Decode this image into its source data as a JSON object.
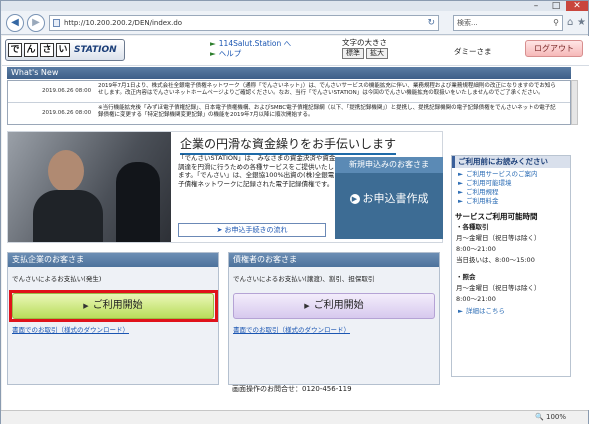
{
  "browser": {
    "url": "http://10.200.200.2/DEN/index.do",
    "search_placeholder": "検索...",
    "controls": [
      "–",
      "□",
      "✕"
    ],
    "zoom": "100%"
  },
  "header": {
    "logo_chars": [
      "で",
      "ん",
      "さ",
      "い"
    ],
    "logo_station": "STATION",
    "links": [
      "114Salut.Station へ",
      "ヘルプ"
    ],
    "font_size_label": "文字の大きさ",
    "font_size_buttons": [
      "標準",
      "拡大"
    ],
    "user": "ダミーさま",
    "logout": "ログアウト"
  },
  "whats_new": {
    "title": "What's New",
    "items": [
      {
        "date": "2019.06.26 08:00",
        "text": "2019年7月1日より、株式会社全銀電子債権ネットワーク（通称「でんさいネット」）は、でんさいサービスの機能拡充に伴い、業務規程および業務規程細則の改正になりますのでお知らせします。改正内容はでんさいネットホームページよりご確認ください。なお、当行「でんさいSTATION」は今回のでんさい機能拡充の取扱いをいたしませんのでご了承ください。"
      },
      {
        "date": "2019.06.26 08:00",
        "text": "※当行機能拡充後「みずほ電子債権記録」、日本電子債権機構、およびSMBC電子債権記録網（以下、「提携記録機関」）と提携し、提携記録機関の電子記録債権をでんさいネットの電子記録債権に変更する「特定記録機関変更記録」の機能を2019年7月以降に順次開始する。"
      }
    ]
  },
  "banner": {
    "title": "企業の円滑な資金繰りをお手伝いします",
    "text": "「でんさいSTATION」は、みなさまの資金決済や資金調達を円滑に行うための各種サービスをご提供いたします。「でんさい」は、全銀協100%出資の(株)全銀電子債権ネットワークに記録された電子記録債権です。",
    "procedure_link": "お申込手続きの流れ",
    "apply_title": "新規申込みのお客さま",
    "apply_button": "お申込書作成"
  },
  "payer": {
    "title": "支払企業のお客さま",
    "desc": "でんさいによるお支払い(発生)",
    "button": "ご利用開始",
    "link": "書面でのお取引（様式のダウンロード）"
  },
  "creditor": {
    "title": "債権者のお客さま",
    "desc": "でんさいによるお支払い(譲渡)、割引、担保取引",
    "button": "ご利用開始",
    "link": "書面でのお取引（様式のダウンロード）"
  },
  "right_panel": {
    "title": "ご利用前にお読みください",
    "links": [
      "ご利用サービスのご案内",
      "ご利用可能環境",
      "ご利用規程",
      "ご利用料金"
    ],
    "hours_title": "サービスご利用可能時間",
    "sections": [
      {
        "name": "・各種取引",
        "lines": [
          "月～金曜日（祝日等は除く）",
          "8:00～21:00",
          "当日扱いは、8:00～15:00"
        ]
      },
      {
        "name": "・照会",
        "lines": [
          "月～金曜日（祝日等は除く）",
          "8:00～21:00"
        ]
      }
    ],
    "detail_link": "詳細はこちら"
  },
  "contact": "画面操作のお問合せ：0120-456-119"
}
